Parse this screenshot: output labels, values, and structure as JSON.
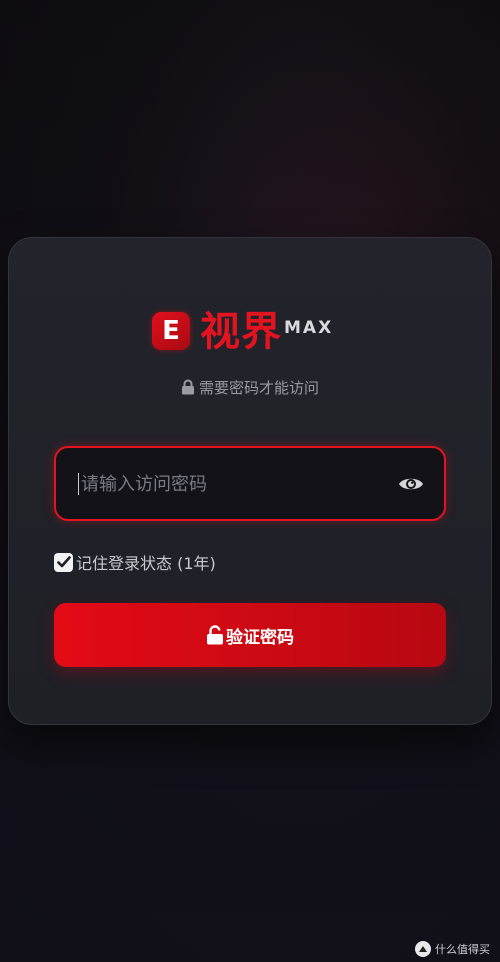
{
  "brand": {
    "logo_letter": "E",
    "name": "视界",
    "suffix": "MAX",
    "accent_color": "#e3141f"
  },
  "subtitle": {
    "icon": "lock-icon",
    "text": "需要密码才能访问"
  },
  "password": {
    "placeholder": "请输入访问密码",
    "value": "",
    "toggle_icon": "eye-icon"
  },
  "remember": {
    "checked": true,
    "label": "记住登录状态 (1年)"
  },
  "verify_button": {
    "icon": "unlock-icon",
    "label": "验证密码"
  },
  "watermark": {
    "text": "什么值得买"
  }
}
